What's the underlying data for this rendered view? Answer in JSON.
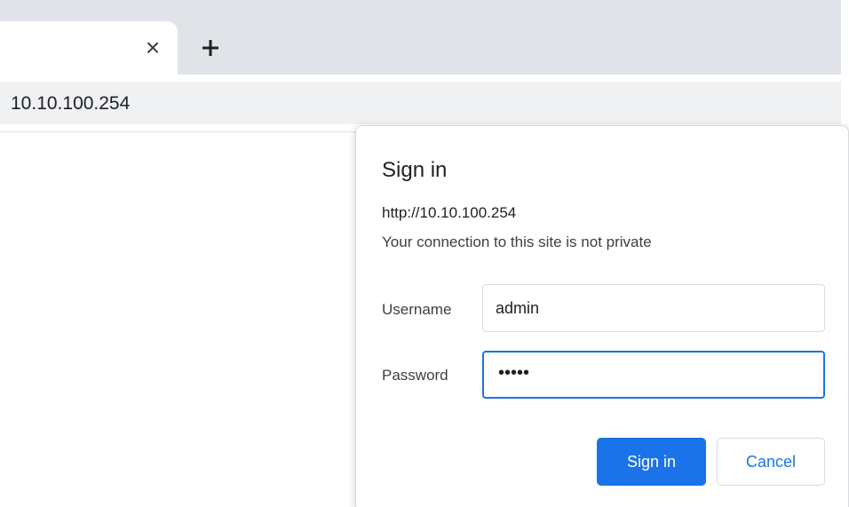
{
  "browser": {
    "tab": {
      "close_glyph": "×",
      "close_icon": "close-icon"
    },
    "new_tab_icon": "plus-icon",
    "address": "10.10.100.254"
  },
  "dialog": {
    "title": "Sign in",
    "url": "http://10.10.100.254",
    "warning": "Your connection to this site is not private",
    "username": {
      "label": "Username",
      "value": "admin"
    },
    "password": {
      "label": "Password",
      "masked_value": "•••••"
    },
    "buttons": {
      "sign_in": "Sign in",
      "cancel": "Cancel"
    }
  },
  "colors": {
    "accent": "#1a73e8",
    "tabstrip": "#e0e3e8",
    "omnibox": "#eff1f3"
  }
}
